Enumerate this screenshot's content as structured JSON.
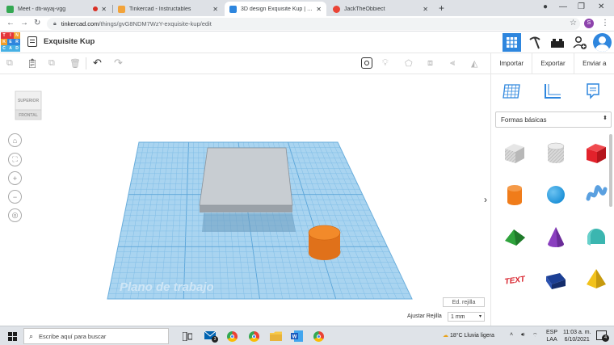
{
  "browser": {
    "tabs": [
      {
        "title": "Meet - dti-wyaj-vgg",
        "favicon_color": "#34a853",
        "has_record_dot": true,
        "active": false
      },
      {
        "title": "Tinkercad - Instructables",
        "favicon_color": "#f2a33a",
        "active": false
      },
      {
        "title": "3D design Exquisite Kup | Tinkerc",
        "favicon_color": "#2e86de",
        "active": true
      },
      {
        "title": "JackTheObbiect",
        "favicon_color": "#ea4335",
        "active": false
      }
    ],
    "close_glyph": "✕",
    "new_tab_glyph": "+",
    "url_host": "tinkercad.com",
    "url_path": "/things/gvG8NDM7WzY-exquisite-kup/edit",
    "profile_initial": "S",
    "icons": [
      "back-icon",
      "forward-icon",
      "reload-icon",
      "lock-icon",
      "star-icon",
      "kebab-icon",
      "minimize-icon",
      "maximize-icon",
      "close-icon"
    ]
  },
  "tinkercad": {
    "logo_letters": [
      "T",
      "I",
      "N",
      "K",
      "E",
      "R",
      "C",
      "A",
      "D"
    ],
    "logo_colors": [
      "#e4353a",
      "#e4353a",
      "#f09e2b",
      "#f09e2b",
      "#2e86de",
      "#2e86de",
      "#46b0e4",
      "#46b0e4",
      "#46b0e4"
    ],
    "project_title": "Exquisite Kup",
    "header_buttons": [
      "3d-view-icon",
      "pickaxe-icon",
      "bricks-icon",
      "add-user-icon",
      "avatar"
    ],
    "actions": {
      "import": "Importar",
      "export": "Exportar",
      "send": "Enviar a"
    },
    "shape_category": "Formas básicas",
    "shapes": [
      {
        "name": "box-hole",
        "color": "#bfbfbf"
      },
      {
        "name": "cylinder-hole",
        "color": "#bfbfbf"
      },
      {
        "name": "box",
        "color": "#e3222b"
      },
      {
        "name": "cylinder",
        "color": "#f07c1a"
      },
      {
        "name": "sphere",
        "color": "#1a8fd6"
      },
      {
        "name": "scribble",
        "color": "#5aa0e0"
      },
      {
        "name": "roof",
        "color": "#2fa33c"
      },
      {
        "name": "cone",
        "color": "#8a3fbf"
      },
      {
        "name": "round-roof",
        "color": "#3bb6b0"
      },
      {
        "name": "text",
        "color": "#d8202a"
      },
      {
        "name": "wedge",
        "color": "#1c3f94"
      },
      {
        "name": "pyramid",
        "color": "#f2c21b"
      }
    ],
    "viewcube": {
      "top": "SUPERIOR",
      "front": "FRONTAL"
    },
    "workplane_label": "Plano de trabajo",
    "edit_grid": "Ed. rejilla",
    "snap_label": "Ajustar Rejilla",
    "snap_value": "1 mm",
    "collapse_glyph": "›"
  },
  "taskbar": {
    "search_placeholder": "Escribe aquí para buscar",
    "weather": "18°C  Lluvia ligera",
    "lang_top": "ESP",
    "lang_bottom": "LAA",
    "time": "11:03 a. m.",
    "date": "6/10/2021",
    "notification_count": "4",
    "mail_count": "3"
  },
  "colors": {
    "grid_fill": "#a9d4f0",
    "grid_line": "#7fbde5",
    "accent": "#2e86de",
    "block_top": "#c8cdd2",
    "block_side": "#9aa1a8"
  }
}
